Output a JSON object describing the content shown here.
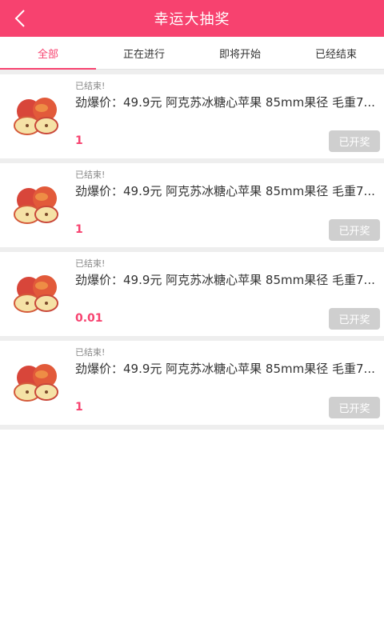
{
  "header": {
    "title": "幸运大抽奖"
  },
  "colors": {
    "accent": "#f7426f",
    "button_disabled": "#cfcfcf"
  },
  "tabs": [
    {
      "label": "全部",
      "active": true
    },
    {
      "label": "正在进行",
      "active": false
    },
    {
      "label": "即将开始",
      "active": false
    },
    {
      "label": "已经结束",
      "active": false
    }
  ],
  "items": [
    {
      "status": "已结束!",
      "name": "劲爆价：49.9元 阿克苏冰糖心苹果 85mm果径 毛重7...",
      "price": "1",
      "button": "已开奖",
      "thumb_icon": "apple-icon"
    },
    {
      "status": "已结束!",
      "name": "劲爆价：49.9元 阿克苏冰糖心苹果 85mm果径 毛重7...",
      "price": "1",
      "button": "已开奖",
      "thumb_icon": "apple-icon"
    },
    {
      "status": "已结束!",
      "name": "劲爆价：49.9元 阿克苏冰糖心苹果 85mm果径 毛重7...",
      "price": "0.01",
      "button": "已开奖",
      "thumb_icon": "apple-icon"
    },
    {
      "status": "已结束!",
      "name": "劲爆价：49.9元 阿克苏冰糖心苹果 85mm果径 毛重7...",
      "price": "1",
      "button": "已开奖",
      "thumb_icon": "apple-icon"
    }
  ]
}
